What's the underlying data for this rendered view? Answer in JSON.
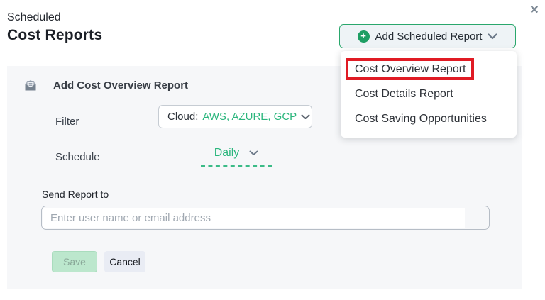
{
  "page": {
    "title_small": "Scheduled",
    "title_large": "Cost Reports"
  },
  "header": {
    "add_report_button_label": "Add Scheduled Report"
  },
  "icons": {
    "close_glyph": "✕",
    "plus_glyph": "+"
  },
  "dropdown_menu": {
    "items": [
      {
        "label": "Cost Overview Report",
        "highlighted": true
      },
      {
        "label": "Cost Details Report",
        "highlighted": false
      },
      {
        "label": "Cost Saving Opportunities",
        "highlighted": false
      }
    ]
  },
  "form": {
    "title": "Add Cost Overview Report",
    "filter": {
      "label": "Filter",
      "field_label": "Cloud:",
      "value": "AWS, AZURE, GCP"
    },
    "schedule": {
      "label": "Schedule",
      "value": "Daily"
    },
    "send_report": {
      "label": "Send Report to",
      "placeholder": "Enter user name or email address",
      "value": ""
    },
    "save_label": "Save",
    "cancel_label": "Cancel"
  },
  "colors": {
    "accent_green": "#2bb67d",
    "button_border_green": "#2aa76c",
    "plus_circle_green": "#1d9e63",
    "annotation_red": "#e01b24",
    "panel_bg": "#f6f7f9"
  }
}
